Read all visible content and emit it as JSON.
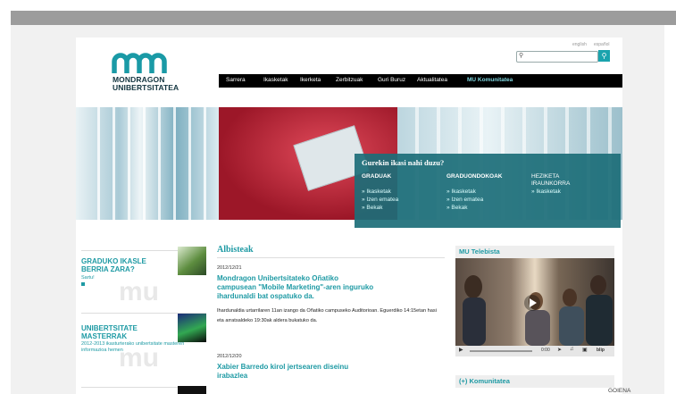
{
  "header": {
    "logo_line1": "MONDRAGON",
    "logo_line2": "UNIBERTSITATEA",
    "lang_en": "english",
    "lang_es": "español",
    "search_placeholder": ""
  },
  "nav": {
    "items": [
      "Sarrera",
      "Ikasketak",
      "Ikerketa",
      "Zerbitzuak",
      "Guri Buruz",
      "Aktualitatea",
      "MU Komunitatea"
    ]
  },
  "promo": {
    "title": "Gurekin ikasi nahi duzu?",
    "cols": [
      {
        "head": "GRADUAK",
        "links": [
          "Ikasketak",
          "Izen ematea",
          "Bekak"
        ]
      },
      {
        "head": "GRADUONDOKOAK",
        "links": [
          "Ikasketak",
          "Izen ematea",
          "Bekak"
        ]
      },
      {
        "head": "HEZIKETA IRAUNKORRA",
        "links": [
          "Ikasketak"
        ]
      }
    ]
  },
  "left": {
    "item1_title": "GRADUKO IKASLE BERRIA ZARA?",
    "item1_sub": "Sartu!",
    "item2_title": "UNIBERTSITATE MASTERRAK",
    "item2_sub": "2012-2013 ikasturterako unibertsitate masteren informazioa hemen"
  },
  "news": {
    "heading": "Albisteak",
    "items": [
      {
        "date": "2012/12/21",
        "title": "Mondragon Unibertsitateko Oñatiko campusean \"Mobile Marketing\"-aren inguruko ihardunaldi bat ospatuko da.",
        "body": "Ihardunaldia urtarrilaren 11an izango da Oñatiko campuseko Auditorioan. Eguerdiko 14:15etan hasi eta arratsaldeko 19:30ak aldera bukatuko da."
      },
      {
        "date": "2012/12/20",
        "title": "Xabier Barredo kirol jertsearen diseinu irabazlea",
        "body": ""
      }
    ]
  },
  "tv": {
    "title": "MU Telebista",
    "time": "0:00"
  },
  "komunitatea": {
    "label": "(+)  Komunitatea"
  },
  "credit": "GOIENA"
}
